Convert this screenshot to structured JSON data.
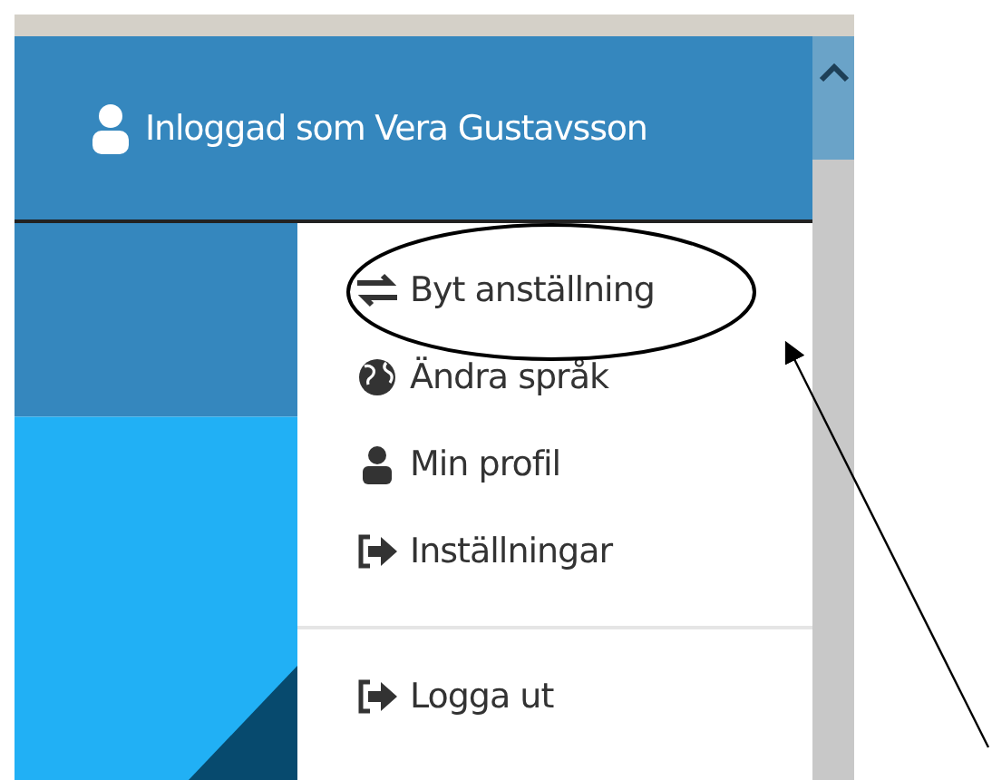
{
  "header": {
    "user_label": "Inloggad som Vera Gustavsson"
  },
  "menu": {
    "sections": [
      {
        "items": [
          {
            "label": "Byt anställning",
            "kind": "arrows"
          },
          {
            "label": "Ändra språk",
            "kind": "globe"
          },
          {
            "label": "Min profil",
            "kind": "user"
          },
          {
            "label": "Inställningar",
            "kind": "signout"
          }
        ]
      },
      {
        "items": [
          {
            "label": "Logga ut",
            "kind": "signout"
          }
        ]
      }
    ]
  }
}
